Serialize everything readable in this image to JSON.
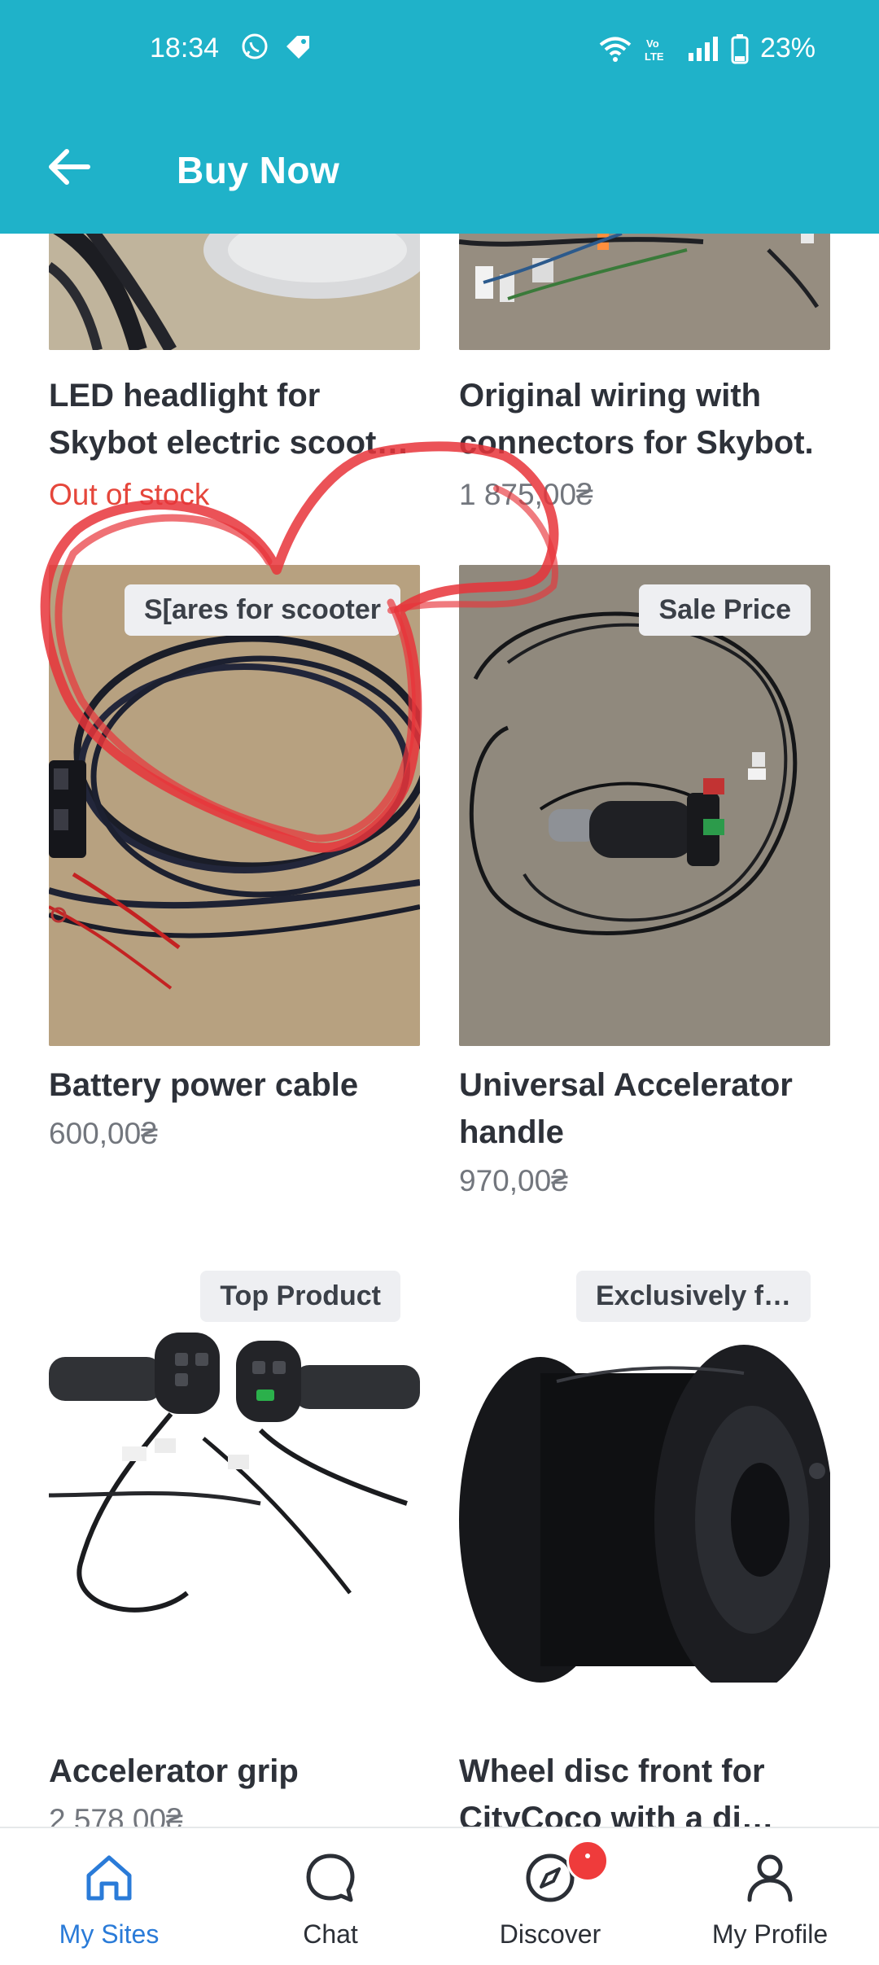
{
  "status_bar": {
    "time": "18:34",
    "battery": "23%",
    "icons": [
      "whatsapp-icon",
      "tag-icon",
      "wifi-icon",
      "volte-icon",
      "signal-icon",
      "battery-icon"
    ]
  },
  "header": {
    "title": "Buy Now",
    "back_icon": "arrow-left-icon",
    "background_color": "#1fb2c9"
  },
  "products": [
    {
      "name": "LED headlight for Skybot electric scoot…",
      "price": "Out of stock",
      "out_of_stock": true,
      "badge": ""
    },
    {
      "name": "Original wiring with connectors for Skybot.",
      "price": "1 875,00₴",
      "badge": ""
    },
    {
      "name": "Battery power cable",
      "price": "600,00₴",
      "badge": "S[ares for scooter"
    },
    {
      "name": "Universal Accelerator handle",
      "price": "970,00₴",
      "badge": "Sale Price"
    },
    {
      "name": "Accelerator grip",
      "price": "2 578,00₴",
      "badge": "Top Product"
    },
    {
      "name": "Wheel disc front for CityCoco with a di…",
      "price": "",
      "badge": "Exclusively f…"
    }
  ],
  "bottom_nav": {
    "items": [
      {
        "label": "My Sites",
        "icon": "home-icon",
        "active": true
      },
      {
        "label": "Chat",
        "icon": "chat-bubble-icon",
        "active": false
      },
      {
        "label": "Discover",
        "icon": "compass-icon",
        "active": false,
        "badge_dot": true
      },
      {
        "label": "My Profile",
        "icon": "person-icon",
        "active": false
      }
    ],
    "active_color": "#2a7bd8"
  },
  "annotation": {
    "color": "#e8343a",
    "shape": "heart scribble"
  }
}
